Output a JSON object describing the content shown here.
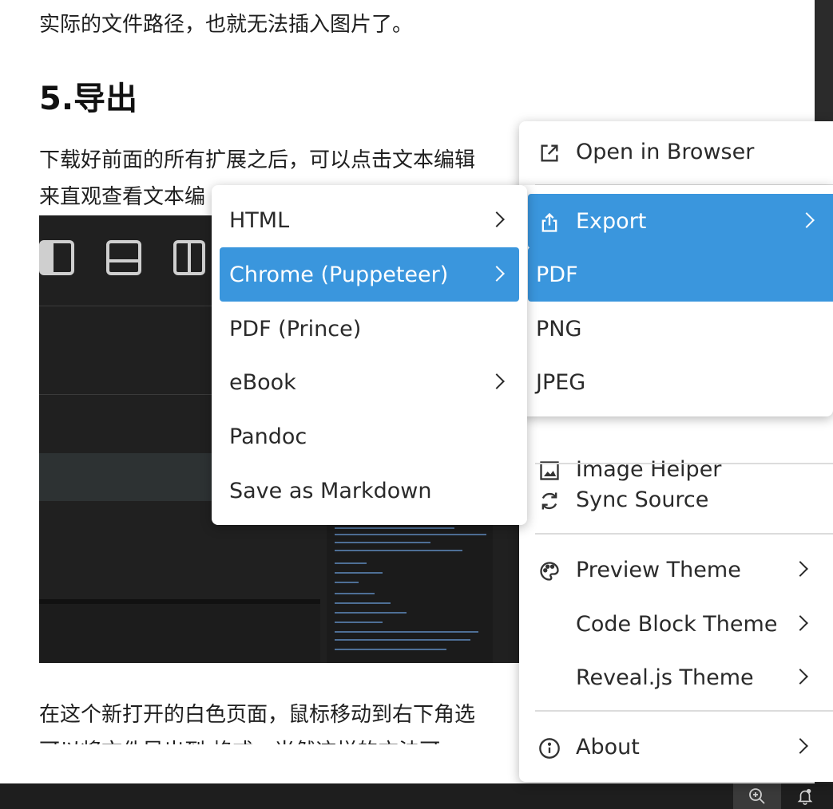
{
  "document": {
    "line_top": "实际的文件路径，也就无法插入图片了。",
    "heading": "5.导出",
    "para1_line1": "下载好前面的所有扩展之后，可以点击文本编辑",
    "para1_line2": "来直观查看文本编",
    "para2_line1": "在这个新打开的白色页面，鼠标移动到右下角选",
    "para2_line2": "可以将文件导出到    格式。当然这样的方法可"
  },
  "context_menu": {
    "items": [
      {
        "label": "Open in Browser",
        "icon": "open-external-icon"
      },
      {
        "label": "Export",
        "icon": "share-export-icon",
        "has_submenu": true,
        "selected": true
      },
      {
        "label": "Image Helper",
        "icon": "image-icon"
      },
      {
        "label": "Sync Source",
        "icon": "sync-icon"
      },
      {
        "label": "Preview Theme",
        "icon": "palette-icon",
        "has_submenu": true
      },
      {
        "label": "Code Block Theme",
        "has_submenu": true
      },
      {
        "label": "Reveal.js Theme",
        "has_submenu": true
      },
      {
        "label": "About",
        "icon": "info-icon",
        "has_submenu": true
      }
    ]
  },
  "export_submenu": {
    "items": [
      {
        "label": "HTML",
        "has_submenu": true
      },
      {
        "label": "Chrome (Puppeteer)",
        "has_submenu": true,
        "selected": true
      },
      {
        "label": "PDF (Prince)"
      },
      {
        "label": "eBook",
        "has_submenu": true
      },
      {
        "label": "Pandoc"
      },
      {
        "label": "Save as Markdown"
      }
    ]
  },
  "chrome_submenu": {
    "items": [
      {
        "label": "PDF",
        "selected": true
      },
      {
        "label": "PNG"
      },
      {
        "label": "JPEG"
      }
    ]
  },
  "statusbar": {
    "icons": [
      "zoom-in-icon",
      "notification-bell-icon"
    ]
  },
  "colors": {
    "selection": "#3a96dd",
    "statusbar": "#1e1e1e",
    "menu_bg": "#ffffff"
  }
}
